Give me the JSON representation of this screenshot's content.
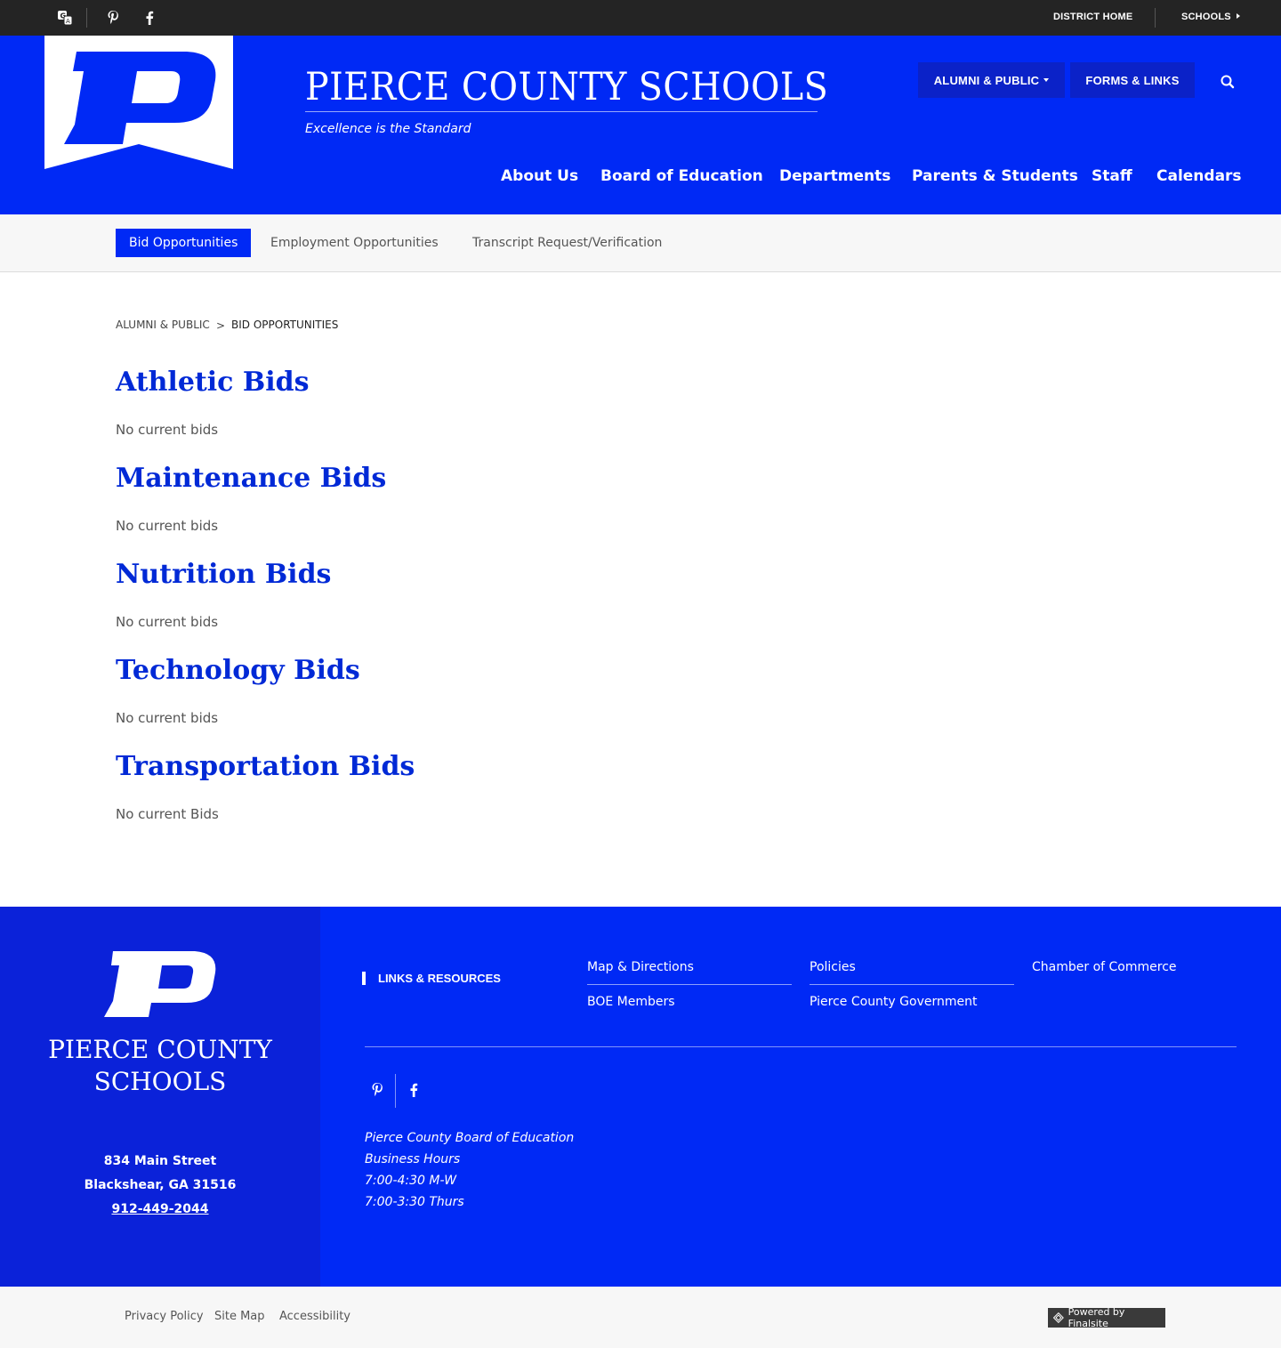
{
  "topbar": {
    "icons": [
      "translate-icon",
      "pinterest-icon",
      "facebook-icon"
    ],
    "district_home": "DISTRICT HOME",
    "schools": "SCHOOLS"
  },
  "header": {
    "site_title": "PIERCE COUNTY SCHOOLS",
    "tagline": "Excellence is the Standard",
    "alumni_btn": "ALUMNI & PUBLIC",
    "forms_btn": "FORMS & LINKS",
    "nav": [
      "About Us",
      "Board of Education",
      "Departments",
      "Parents & Students",
      "Staff",
      "Calendars"
    ]
  },
  "subnav": {
    "tabs": [
      "Bid Opportunities",
      "Employment Opportunities",
      "Transcript Request/Verification"
    ]
  },
  "breadcrumb": {
    "parent": "ALUMNI & PUBLIC",
    "separator": ">",
    "current": "BID OPPORTUNITIES"
  },
  "bids": [
    {
      "title": "Athletic Bids",
      "status": "No current bids"
    },
    {
      "title": "Maintenance Bids",
      "status": "No current bids"
    },
    {
      "title": "Nutrition Bids",
      "status": "No current bids"
    },
    {
      "title": "Technology Bids",
      "status": "No current bids"
    },
    {
      "title": "Transportation Bids",
      "status": "No current Bids"
    }
  ],
  "footer": {
    "title_line1": "PIERCE COUNTY",
    "title_line2": "SCHOOLS",
    "address1": "834 Main Street",
    "address2": "Blackshear, GA  31516",
    "phone": "912-449-2044",
    "links_heading": "LINKS & RESOURCES",
    "links": [
      "Map & Directions",
      "Policies",
      "Chamber of Commerce",
      "BOE Members",
      "Pierce County Government"
    ],
    "hours": [
      "Pierce County Board of Education",
      "Business Hours",
      "7:00-4:30 M-W",
      "7:00-3:30 Thurs"
    ]
  },
  "bottombar": {
    "links": [
      "Privacy Policy",
      "Site Map",
      "Accessibility"
    ],
    "powered_by": "Powered by Finalsite"
  },
  "colors": {
    "brand_blue": "#0029f5",
    "dark_blue": "#0b22c8",
    "heading_blue": "#0029d6",
    "topbar": "#242424"
  }
}
